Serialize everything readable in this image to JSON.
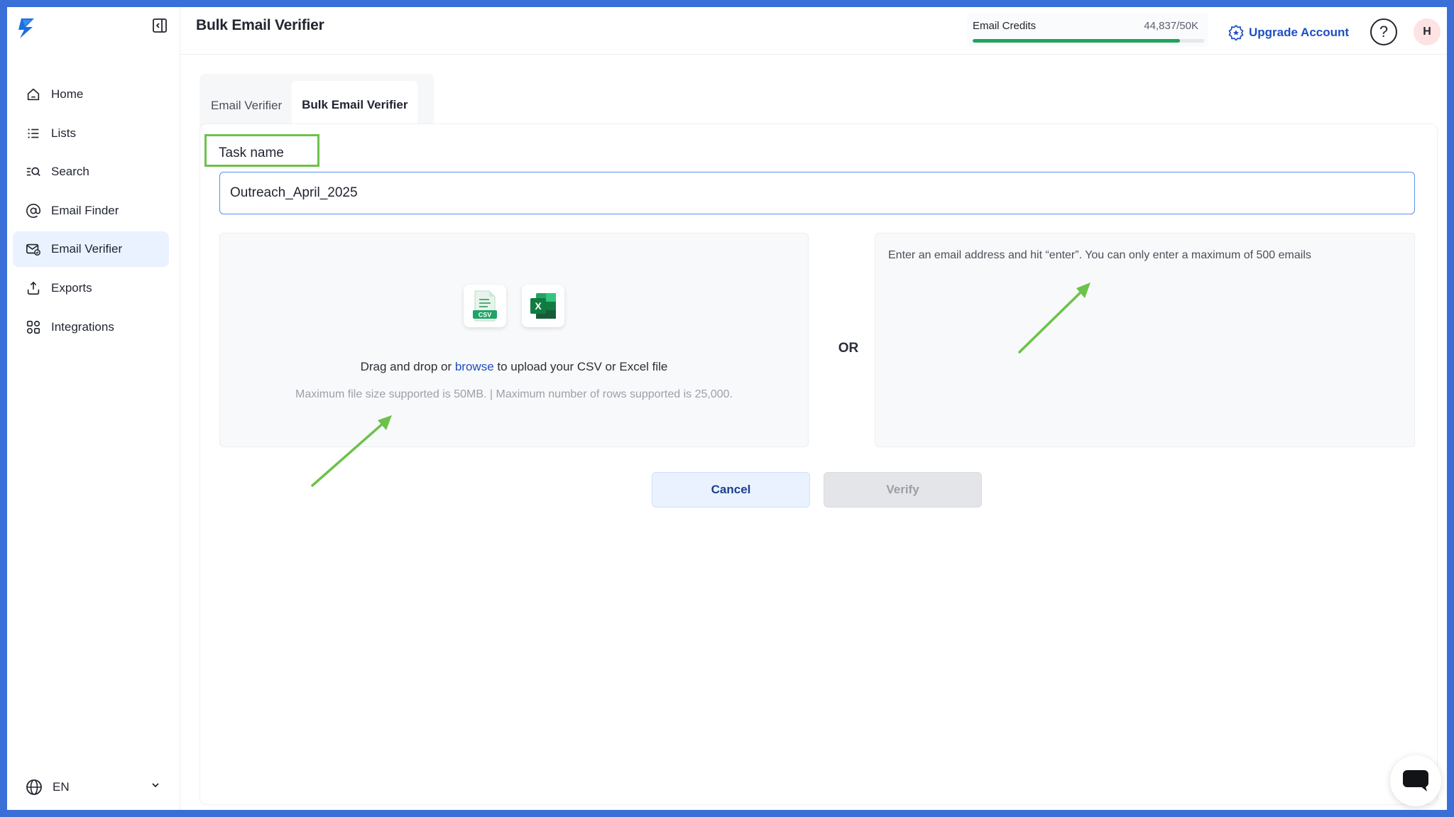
{
  "app": {
    "page_title": "Bulk Email Verifier"
  },
  "sidebar": {
    "items": [
      {
        "label": "Home",
        "icon": "home-icon",
        "active": false
      },
      {
        "label": "Lists",
        "icon": "list-icon",
        "active": false
      },
      {
        "label": "Search",
        "icon": "search-icon",
        "active": false
      },
      {
        "label": "Email Finder",
        "icon": "at-icon",
        "active": false
      },
      {
        "label": "Email Verifier",
        "icon": "mail-check-icon",
        "active": true
      },
      {
        "label": "Exports",
        "icon": "export-icon",
        "active": false
      },
      {
        "label": "Integrations",
        "icon": "integrations-icon",
        "active": false
      }
    ],
    "language": "EN"
  },
  "header": {
    "credits_label": "Email Credits",
    "credits_value": "44,837/50K",
    "credits_fraction": 0.897,
    "upgrade_label": "Upgrade Account",
    "help_label": "?",
    "avatar_initial": "H"
  },
  "tabs": [
    {
      "label": "Email Verifier",
      "active": false
    },
    {
      "label": "Bulk Email Verifier",
      "active": true
    }
  ],
  "form": {
    "task_name_label": "Task name",
    "task_name_value": "Outreach_April_2025",
    "drop_text_before": "Drag and drop or ",
    "drop_browse": "browse",
    "drop_text_after": " to upload your CSV or Excel file",
    "drop_hint": "Maximum file size supported is 50MB. | Maximum number of rows supported is 25,000.",
    "or_label": "OR",
    "email_placeholder": "Enter an email address and hit “enter”. You can only enter a maximum of 500 emails",
    "cancel_label": "Cancel",
    "verify_label": "Verify",
    "csv_badge": "CSV",
    "excel_badge": "X"
  },
  "colors": {
    "accent": "#1d4fc4",
    "annotation": "#6cc24a",
    "progress": "#1fa35a",
    "frame": "#3a6fd8"
  }
}
